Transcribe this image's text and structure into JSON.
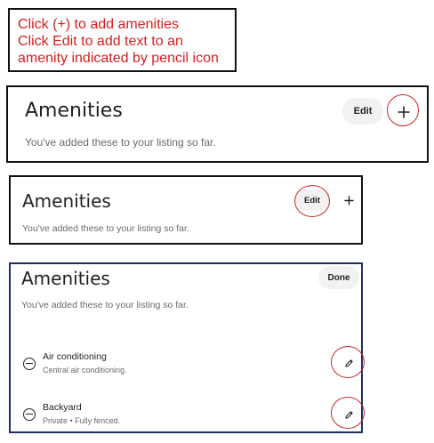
{
  "instructions": {
    "line1": "Click (+) to add amenities",
    "line2": "Click Edit to add text to an",
    "line3": "amenity indicated by pencil icon",
    "color": "#d81e1e"
  },
  "panel_add": {
    "title": "Amenities",
    "subtitle": "You've added these to your listing so far.",
    "edit_label": "Edit",
    "add_icon": "plus-icon"
  },
  "panel_edit": {
    "title": "Amenities",
    "subtitle": "You've added these to your listing so far.",
    "edit_label": "Edit",
    "add_icon": "plus-icon"
  },
  "panel_editing": {
    "title": "Amenities",
    "subtitle": "You've added these to your listing so far.",
    "done_label": "Done",
    "amenities": [
      {
        "name": "Air conditioning",
        "description": "Central air conditioning.",
        "remove_icon": "minus-circle-icon",
        "edit_icon": "pencil-icon"
      },
      {
        "name": "Backyard",
        "description": "Private • Fully fenced.",
        "remove_icon": "minus-circle-icon",
        "edit_icon": "pencil-icon"
      }
    ]
  },
  "highlight_color": "#c62828"
}
